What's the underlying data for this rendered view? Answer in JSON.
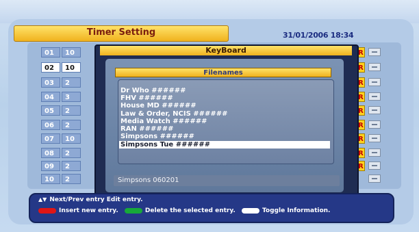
{
  "header": {
    "title": "Timer Setting",
    "datetime": "31/01/2006 18:34"
  },
  "timers": [
    {
      "num": "01",
      "time": "10",
      "selected": false
    },
    {
      "num": "02",
      "time": "10",
      "selected": true
    },
    {
      "num": "03",
      "time": "2",
      "selected": false
    },
    {
      "num": "04",
      "time": "3",
      "selected": false
    },
    {
      "num": "05",
      "time": "2",
      "selected": false
    },
    {
      "num": "06",
      "time": "2",
      "selected": false
    },
    {
      "num": "07",
      "time": "10",
      "selected": false
    },
    {
      "num": "08",
      "time": "2",
      "selected": false
    },
    {
      "num": "09",
      "time": "2",
      "selected": false
    },
    {
      "num": "10",
      "time": "2",
      "selected": false
    }
  ],
  "repeat_label": "R",
  "keyboard": {
    "title": "KeyBoard",
    "filenames_title": "Filenames",
    "filenames": [
      "Dr Who ######",
      "FHV ######",
      "House MD ######",
      "Law & Order, NCIS ######",
      "Media Watch ######",
      "RAN ######",
      "Simpsons ######",
      "Simpsons Tue ######"
    ],
    "selected_index": 7,
    "input_value": "Simpsons 060201"
  },
  "help": {
    "line1": "Next/Prev entry  Edit entry.",
    "red_label": "Insert new entry.",
    "green_label": "Delete the selected entry.",
    "white_label": "Toggle Information."
  },
  "colors": {
    "red": "#e01616",
    "green": "#17a83a",
    "white": "#ffffff",
    "title_gold": "#f0b21e"
  }
}
